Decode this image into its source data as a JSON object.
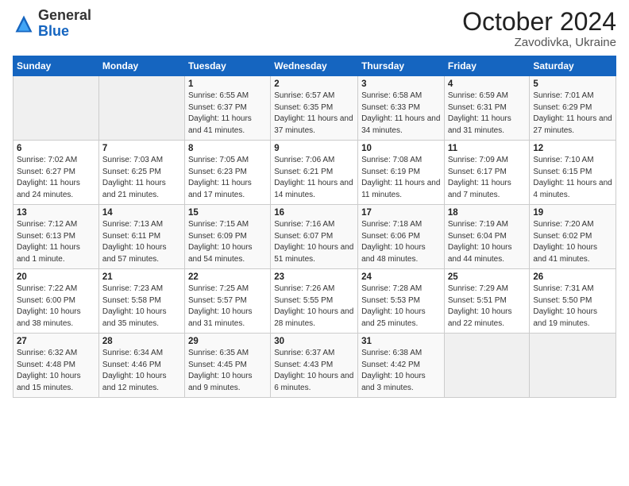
{
  "logo": {
    "general": "General",
    "blue": "Blue"
  },
  "title": "October 2024",
  "subtitle": "Zavodivka, Ukraine",
  "days_header": [
    "Sunday",
    "Monday",
    "Tuesday",
    "Wednesday",
    "Thursday",
    "Friday",
    "Saturday"
  ],
  "weeks": [
    [
      {
        "day": "",
        "info": ""
      },
      {
        "day": "",
        "info": ""
      },
      {
        "day": "1",
        "info": "Sunrise: 6:55 AM\nSunset: 6:37 PM\nDaylight: 11 hours and 41 minutes."
      },
      {
        "day": "2",
        "info": "Sunrise: 6:57 AM\nSunset: 6:35 PM\nDaylight: 11 hours and 37 minutes."
      },
      {
        "day": "3",
        "info": "Sunrise: 6:58 AM\nSunset: 6:33 PM\nDaylight: 11 hours and 34 minutes."
      },
      {
        "day": "4",
        "info": "Sunrise: 6:59 AM\nSunset: 6:31 PM\nDaylight: 11 hours and 31 minutes."
      },
      {
        "day": "5",
        "info": "Sunrise: 7:01 AM\nSunset: 6:29 PM\nDaylight: 11 hours and 27 minutes."
      }
    ],
    [
      {
        "day": "6",
        "info": "Sunrise: 7:02 AM\nSunset: 6:27 PM\nDaylight: 11 hours and 24 minutes."
      },
      {
        "day": "7",
        "info": "Sunrise: 7:03 AM\nSunset: 6:25 PM\nDaylight: 11 hours and 21 minutes."
      },
      {
        "day": "8",
        "info": "Sunrise: 7:05 AM\nSunset: 6:23 PM\nDaylight: 11 hours and 17 minutes."
      },
      {
        "day": "9",
        "info": "Sunrise: 7:06 AM\nSunset: 6:21 PM\nDaylight: 11 hours and 14 minutes."
      },
      {
        "day": "10",
        "info": "Sunrise: 7:08 AM\nSunset: 6:19 PM\nDaylight: 11 hours and 11 minutes."
      },
      {
        "day": "11",
        "info": "Sunrise: 7:09 AM\nSunset: 6:17 PM\nDaylight: 11 hours and 7 minutes."
      },
      {
        "day": "12",
        "info": "Sunrise: 7:10 AM\nSunset: 6:15 PM\nDaylight: 11 hours and 4 minutes."
      }
    ],
    [
      {
        "day": "13",
        "info": "Sunrise: 7:12 AM\nSunset: 6:13 PM\nDaylight: 11 hours and 1 minute."
      },
      {
        "day": "14",
        "info": "Sunrise: 7:13 AM\nSunset: 6:11 PM\nDaylight: 10 hours and 57 minutes."
      },
      {
        "day": "15",
        "info": "Sunrise: 7:15 AM\nSunset: 6:09 PM\nDaylight: 10 hours and 54 minutes."
      },
      {
        "day": "16",
        "info": "Sunrise: 7:16 AM\nSunset: 6:07 PM\nDaylight: 10 hours and 51 minutes."
      },
      {
        "day": "17",
        "info": "Sunrise: 7:18 AM\nSunset: 6:06 PM\nDaylight: 10 hours and 48 minutes."
      },
      {
        "day": "18",
        "info": "Sunrise: 7:19 AM\nSunset: 6:04 PM\nDaylight: 10 hours and 44 minutes."
      },
      {
        "day": "19",
        "info": "Sunrise: 7:20 AM\nSunset: 6:02 PM\nDaylight: 10 hours and 41 minutes."
      }
    ],
    [
      {
        "day": "20",
        "info": "Sunrise: 7:22 AM\nSunset: 6:00 PM\nDaylight: 10 hours and 38 minutes."
      },
      {
        "day": "21",
        "info": "Sunrise: 7:23 AM\nSunset: 5:58 PM\nDaylight: 10 hours and 35 minutes."
      },
      {
        "day": "22",
        "info": "Sunrise: 7:25 AM\nSunset: 5:57 PM\nDaylight: 10 hours and 31 minutes."
      },
      {
        "day": "23",
        "info": "Sunrise: 7:26 AM\nSunset: 5:55 PM\nDaylight: 10 hours and 28 minutes."
      },
      {
        "day": "24",
        "info": "Sunrise: 7:28 AM\nSunset: 5:53 PM\nDaylight: 10 hours and 25 minutes."
      },
      {
        "day": "25",
        "info": "Sunrise: 7:29 AM\nSunset: 5:51 PM\nDaylight: 10 hours and 22 minutes."
      },
      {
        "day": "26",
        "info": "Sunrise: 7:31 AM\nSunset: 5:50 PM\nDaylight: 10 hours and 19 minutes."
      }
    ],
    [
      {
        "day": "27",
        "info": "Sunrise: 6:32 AM\nSunset: 4:48 PM\nDaylight: 10 hours and 15 minutes."
      },
      {
        "day": "28",
        "info": "Sunrise: 6:34 AM\nSunset: 4:46 PM\nDaylight: 10 hours and 12 minutes."
      },
      {
        "day": "29",
        "info": "Sunrise: 6:35 AM\nSunset: 4:45 PM\nDaylight: 10 hours and 9 minutes."
      },
      {
        "day": "30",
        "info": "Sunrise: 6:37 AM\nSunset: 4:43 PM\nDaylight: 10 hours and 6 minutes."
      },
      {
        "day": "31",
        "info": "Sunrise: 6:38 AM\nSunset: 4:42 PM\nDaylight: 10 hours and 3 minutes."
      },
      {
        "day": "",
        "info": ""
      },
      {
        "day": "",
        "info": ""
      }
    ]
  ]
}
